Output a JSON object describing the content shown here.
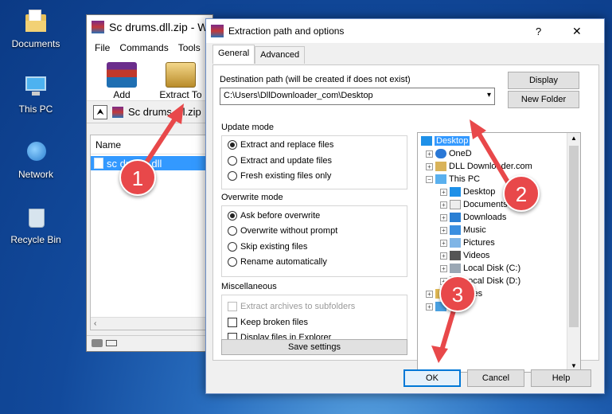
{
  "desktop": {
    "icons": [
      {
        "label": "Documents"
      },
      {
        "label": "This PC"
      },
      {
        "label": "Network"
      },
      {
        "label": "Recycle Bin"
      }
    ]
  },
  "winrar": {
    "title": "Sc drums.dll.zip - W",
    "menu": [
      "File",
      "Commands",
      "Tools"
    ],
    "toolbar": {
      "add": "Add",
      "extract_to": "Extract To"
    },
    "path": "Sc drums.dll.zip",
    "list_header": "Name",
    "files": [
      "sc drums.dll"
    ]
  },
  "dialog": {
    "title": "Extraction path and options",
    "help_glyph": "?",
    "close_glyph": "✕",
    "tabs": [
      "General",
      "Advanced"
    ],
    "dest_label": "Destination path (will be created if does not exist)",
    "dest_value": "C:\\Users\\DllDownloader_com\\Desktop",
    "display_btn": "Display",
    "new_folder_btn": "New Folder",
    "update_mode": {
      "title": "Update mode",
      "options": [
        "Extract and replace files",
        "Extract and update files",
        "Fresh existing files only"
      ],
      "selected": 0
    },
    "overwrite_mode": {
      "title": "Overwrite mode",
      "options": [
        "Ask before overwrite",
        "Overwrite without prompt",
        "Skip existing files",
        "Rename automatically"
      ],
      "selected": 0
    },
    "misc": {
      "title": "Miscellaneous",
      "options": [
        "Extract archives to subfolders",
        "Keep broken files",
        "Display files in Explorer"
      ]
    },
    "save_settings": "Save settings",
    "tree": {
      "root": "Desktop",
      "items": [
        "OneD",
        "DLL Downloader.com",
        "This PC",
        "Desktop",
        "Documents",
        "Downloads",
        "Music",
        "Pictures",
        "Videos",
        "Local Disk (C:)",
        "Local Disk (D:)",
        "Libraries",
        "ork"
      ]
    },
    "ok": "OK",
    "cancel": "Cancel",
    "help": "Help"
  },
  "annotations": [
    "1",
    "2",
    "3"
  ],
  "colors": {
    "arrow": "#e8484a",
    "selection": "#3399ff",
    "accent": "#0078d7"
  }
}
